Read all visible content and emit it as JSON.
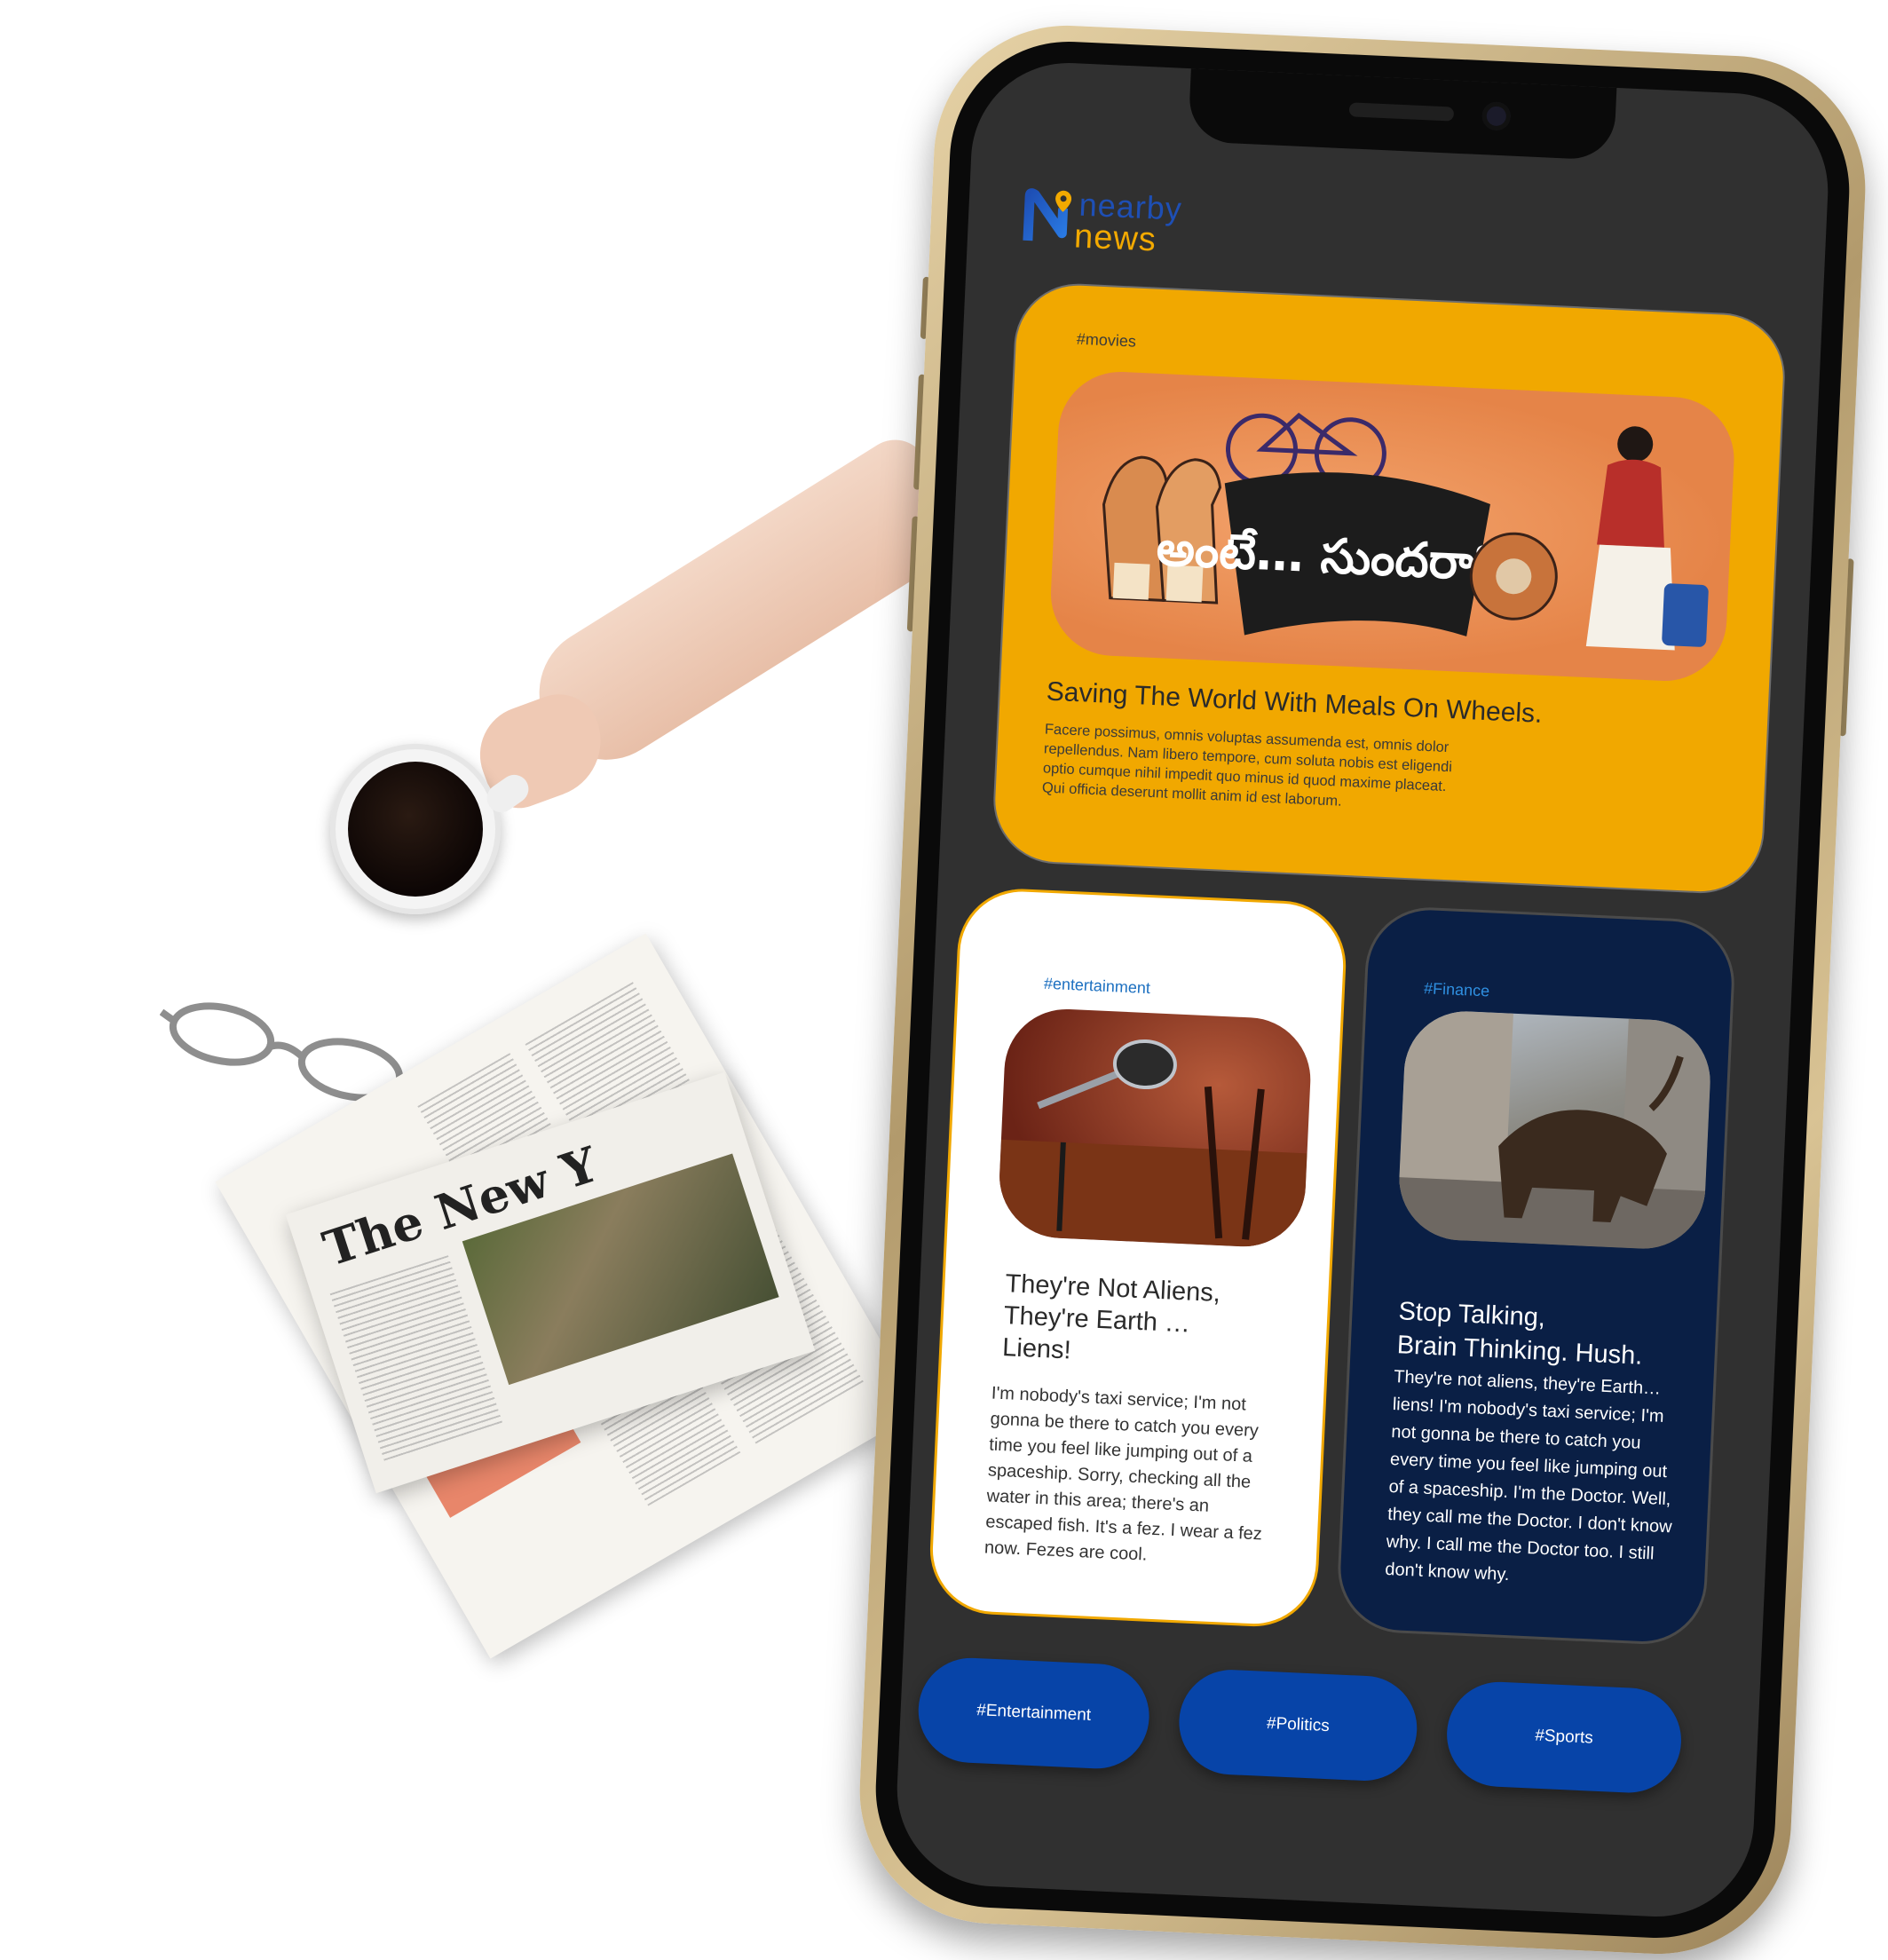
{
  "app": {
    "logo_line1": "nearby",
    "logo_line2": "news",
    "brand_colors": {
      "blue": "#1e4fb5",
      "yellow": "#f2a900"
    }
  },
  "featured": {
    "tag": "#movies",
    "title": "Saving The World With Meals On Wheels.",
    "body": "Facere possimus, omnis voluptas assumenda est, omnis dolor repellendus. Nam libero tempore, cum soluta nobis est eligendi optio cumque nihil impedit quo minus id quod maxime placeat. Qui officia deserunt mollit anim id est laborum.",
    "banner_text": "అంటే… సుందరానికీ!",
    "color": "#f1a800"
  },
  "entertainment": {
    "tag": "#entertainment",
    "title": "They're Not Aliens, They're Earth …Liens!",
    "body": "I'm nobody's taxi service; I'm not gonna be there to catch you every time you feel like jumping out of a spaceship. Sorry, checking all the water in this area; there's an escaped fish. It's a fez. I wear a fez now. Fezes are cool.",
    "image_icon": "microphone-icon"
  },
  "finance": {
    "tag": "#Finance",
    "title_line1": "Stop Talking,",
    "title_line2": "Brain Thinking. Hush.",
    "body": "They're not aliens, they're Earth…liens! I'm nobody's taxi service; I'm not gonna be there to catch you every time you feel like jumping out of a spaceship. I'm the Doctor. Well, they call me the Doctor. I don't know why. I call me the Doctor too. I still don't know why.",
    "image_icon": "charging-bull-icon",
    "color": "#0a1f45"
  },
  "categories": [
    {
      "label": "#Entertainment"
    },
    {
      "label": "#Politics"
    },
    {
      "label": "#Sports"
    }
  ],
  "scene": {
    "newspaper_masthead": "The New Y"
  }
}
